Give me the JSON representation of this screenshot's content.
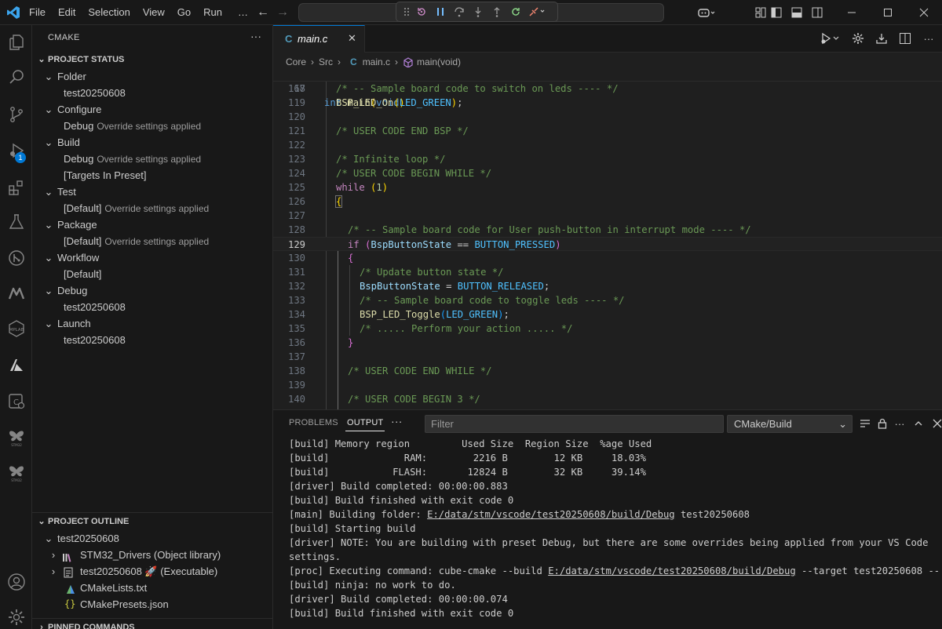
{
  "menu": [
    "File",
    "Edit",
    "Selection",
    "View",
    "Go",
    "Run",
    "…"
  ],
  "colors": {
    "accent": "#0078d4",
    "vscode_blue": "#3ba4ec"
  },
  "sidebar": {
    "title": "CMAKE",
    "project_status": {
      "header": "PROJECT STATUS",
      "rows": [
        {
          "label": "Folder",
          "desc": ""
        },
        {
          "label": "test20250608",
          "desc": ""
        },
        {
          "label": "Configure",
          "desc": ""
        },
        {
          "label": "Debug",
          "desc": "Override settings applied"
        },
        {
          "label": "Build",
          "desc": ""
        },
        {
          "label": "Debug",
          "desc": "Override settings applied"
        },
        {
          "label": "[Targets In Preset]",
          "desc": ""
        },
        {
          "label": "Test",
          "desc": ""
        },
        {
          "label": "[Default]",
          "desc": "Override settings applied"
        },
        {
          "label": "Package",
          "desc": ""
        },
        {
          "label": "[Default]",
          "desc": "Override settings applied"
        },
        {
          "label": "Workflow",
          "desc": ""
        },
        {
          "label": "[Default]",
          "desc": ""
        },
        {
          "label": "Debug",
          "desc": ""
        },
        {
          "label": "test20250608",
          "desc": ""
        },
        {
          "label": "Launch",
          "desc": ""
        },
        {
          "label": "test20250608",
          "desc": ""
        }
      ]
    },
    "project_outline": {
      "header": "PROJECT OUTLINE",
      "rows": [
        {
          "label": "test20250608"
        },
        {
          "label": "STM32_Drivers (Object library)"
        },
        {
          "label": "test20250608 🚀 (Executable)"
        },
        {
          "label": "CMakeLists.txt"
        },
        {
          "label": "CMakePresets.json"
        }
      ]
    },
    "pinned_commands": {
      "header": "PINNED COMMANDS"
    }
  },
  "activity": {
    "debug_badge": "1"
  },
  "editor": {
    "tab_icon": "C",
    "tab_label": "main.c",
    "breadcrumb": [
      "Core",
      "Src",
      "main.c",
      "main(void)"
    ],
    "sticky_line_number": "67",
    "lines": [
      {
        "n": "118"
      },
      {
        "n": "119"
      },
      {
        "n": "120"
      },
      {
        "n": "121"
      },
      {
        "n": "122"
      },
      {
        "n": "123"
      },
      {
        "n": "124"
      },
      {
        "n": "125"
      },
      {
        "n": "126"
      },
      {
        "n": "127"
      },
      {
        "n": "128"
      },
      {
        "n": "129"
      },
      {
        "n": "130"
      },
      {
        "n": "131"
      },
      {
        "n": "132"
      },
      {
        "n": "133"
      },
      {
        "n": "134"
      },
      {
        "n": "135"
      },
      {
        "n": "136"
      },
      {
        "n": "137"
      },
      {
        "n": "138"
      },
      {
        "n": "139"
      },
      {
        "n": "140"
      }
    ],
    "code_text": {
      "sticky": "int main(void)",
      "l118": "/* -- Sample board code to switch on leds ---- */",
      "l119_fn": "BSP_LED_On",
      "l119_arg": "LED_GREEN",
      "l121": "/* USER CODE END BSP */",
      "l123": "/* Infinite loop */",
      "l124": "/* USER CODE BEGIN WHILE */",
      "l125_kw": "while",
      "l125_num": "1",
      "l128": "/* -- Sample board code for User push-button in interrupt mode ---- */",
      "l129_kw": "if",
      "l129_var": "BspButtonState",
      "l129_op": " == ",
      "l129_mac": "BUTTON_PRESSED",
      "l131": "/* Update button state */",
      "l132_var": "BspButtonState",
      "l132_op": " = ",
      "l132_mac": "BUTTON_RELEASED",
      "l133": "/* -- Sample board code to toggle leds ---- */",
      "l134_fn": "BSP_LED_Toggle",
      "l134_arg": "LED_GREEN",
      "l135": "/* ..... Perform your action ..... */",
      "l138": "/* USER CODE END WHILE */",
      "l140": "/* USER CODE BEGIN 3 */"
    }
  },
  "panel": {
    "tabs": [
      "PROBLEMS",
      "OUTPUT"
    ],
    "filter_placeholder": "Filter",
    "channel": "CMake/Build",
    "output": [
      "[build] Memory region         Used Size  Region Size  %age Used",
      "[build]             RAM:        2216 B        12 KB     18.03%",
      "[build]           FLASH:       12824 B        32 KB     39.14%",
      "[driver] Build completed: 00:00:00.883",
      "[build] Build finished with exit code 0",
      "[main] Building folder: ",
      "[build] Starting build",
      "[driver] NOTE: You are building with preset Debug, but there are some overrides being applied from your VS Code",
      "settings.",
      "[proc] Executing command: cube-cmake --build ",
      "[build] ninja: no work to do.",
      "[driver] Build completed: 00:00:00.074",
      "[build] Build finished with exit code 0"
    ],
    "path": "E:/data/stm/vscode/test20250608/build/Debug",
    "main_suffix": " test20250608",
    "proc_suffix": " --target test20250608 --"
  }
}
